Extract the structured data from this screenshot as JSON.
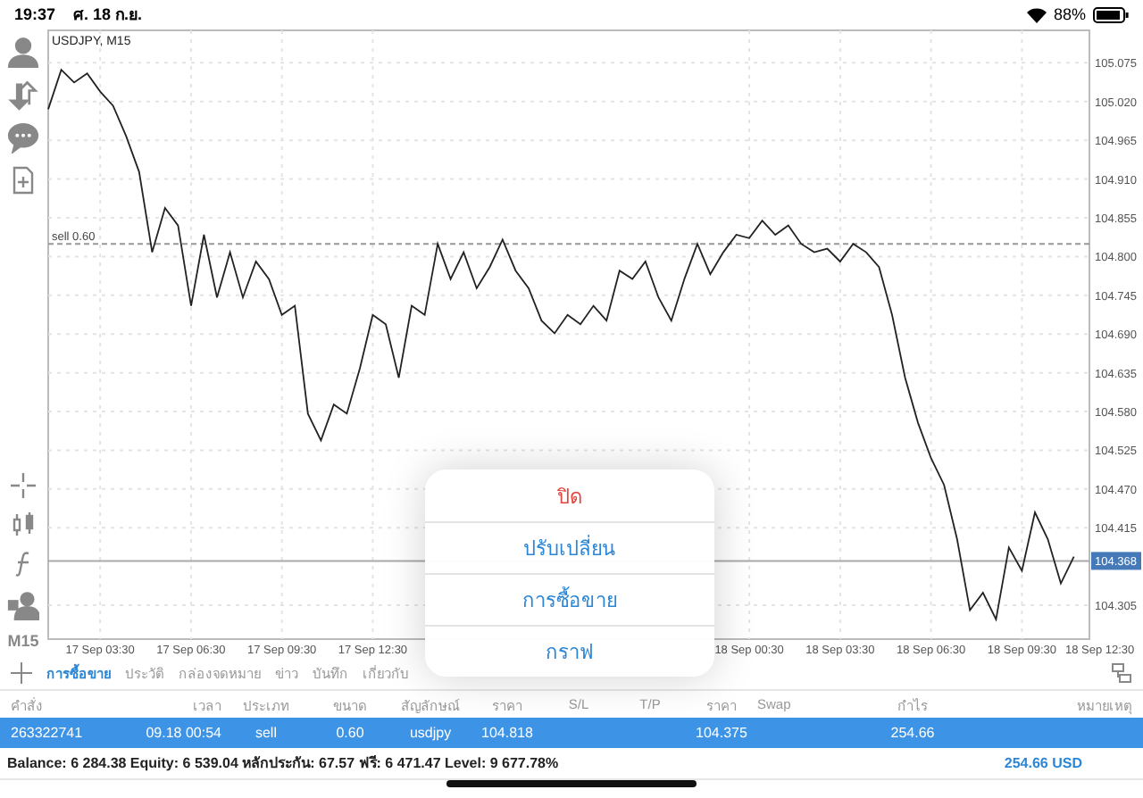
{
  "status_bar": {
    "time": "19:37",
    "date": "ศ. 18 ก.ย.",
    "battery": "88%"
  },
  "toolbar": {
    "timeframe": "M15"
  },
  "chart": {
    "chart_data": {
      "type": "line",
      "title": "USDJPY, M15",
      "grid": true,
      "ylim": [
        104.257,
        105.121
      ],
      "categories": [
        null,
        null,
        null,
        null,
        "17 Sep 03:30",
        null,
        null,
        null,
        null,
        null,
        null,
        "17 Sep 06:30",
        null,
        null,
        null,
        null,
        null,
        null,
        "17 Sep 09:30",
        null,
        null,
        null,
        null,
        null,
        null,
        "17 Sep 12:30",
        null,
        null,
        null,
        null,
        null,
        null,
        null,
        null,
        null,
        null,
        null,
        null,
        null,
        null,
        null,
        null,
        null,
        null,
        null,
        null,
        null,
        null,
        null,
        null,
        null,
        null,
        null,
        null,
        "18 Sep 00:30",
        null,
        null,
        null,
        null,
        null,
        null,
        "18 Sep 03:30",
        null,
        null,
        null,
        null,
        null,
        null,
        "18 Sep 06:30",
        null,
        null,
        null,
        null,
        null,
        null,
        "18 Sep 09:30",
        null,
        null,
        null,
        null,
        null,
        "18 Sep 12:30"
      ],
      "yticks": [
        {
          "value": 105.075,
          "label": "105.075"
        },
        {
          "value": 105.02,
          "label": "105.020"
        },
        {
          "value": 104.965,
          "label": "104.965"
        },
        {
          "value": 104.91,
          "label": "104.910"
        },
        {
          "value": 104.855,
          "label": "104.855"
        },
        {
          "value": 104.8,
          "label": "104.800"
        },
        {
          "value": 104.745,
          "label": "104.745"
        },
        {
          "value": 104.69,
          "label": "104.690"
        },
        {
          "value": 104.635,
          "label": "104.635"
        },
        {
          "value": 104.58,
          "label": "104.580"
        },
        {
          "value": 104.525,
          "label": "104.525"
        },
        {
          "value": 104.47,
          "label": "104.470"
        },
        {
          "value": 104.415,
          "label": "104.415"
        },
        {
          "value": 104.305,
          "label": "104.305"
        }
      ],
      "series": [
        {
          "color": "#222222",
          "values": [
            105.009,
            105.065,
            105.047,
            105.06,
            105.034,
            105.014,
            104.971,
            104.92,
            104.806,
            104.869,
            104.844,
            104.73,
            104.831,
            104.742,
            104.806,
            104.742,
            104.793,
            104.768,
            104.717,
            104.73,
            104.577,
            104.539,
            104.59,
            104.577,
            104.641,
            104.717,
            104.704,
            104.628,
            104.73,
            104.717,
            104.818,
            104.768,
            104.806,
            104.755,
            104.785,
            104.824,
            104.78,
            104.755,
            104.709,
            104.691,
            104.717,
            104.704,
            104.73,
            104.709,
            104.78,
            104.768,
            104.793,
            104.742,
            104.709,
            104.768,
            104.818,
            104.775,
            104.806,
            104.831,
            104.826,
            104.851,
            104.831,
            104.844,
            104.818,
            104.806,
            104.811,
            104.793,
            104.818,
            104.806,
            104.785,
            104.717,
            104.628,
            104.564,
            104.514,
            104.476,
            104.399,
            104.298,
            104.323,
            104.285,
            104.387,
            104.354,
            104.437,
            104.399,
            104.336,
            104.374,
            null,
            null
          ]
        }
      ],
      "ref_lines": [
        {
          "axis": "y",
          "value": 104.818,
          "label": "sell 0.60"
        },
        {
          "axis": "y",
          "value": 104.368,
          "label": "104.368"
        }
      ]
    }
  },
  "tabs": [
    {
      "label": "การซื้อขาย",
      "selected": true
    },
    {
      "label": "ประวัติ",
      "selected": false
    },
    {
      "label": "กล่องจดหมาย",
      "selected": false
    },
    {
      "label": "ข่าว",
      "selected": false
    },
    {
      "label": "บันทึก",
      "selected": false
    },
    {
      "label": "เกี่ยวกับ",
      "selected": false
    }
  ],
  "table": {
    "columns": [
      "คำสั่ง",
      "เวลา",
      "ประเภท",
      "ขนาด",
      "สัญลักษณ์",
      "ราคา",
      "S/L",
      "T/P",
      "ราคา",
      "Swap",
      "กำไร",
      "หมายเหตุ"
    ],
    "rows": [
      {
        "selected": true,
        "cells": [
          "263322741",
          "09.18 00:54",
          "sell",
          "0.60",
          "usdjpy",
          "104.818",
          "",
          "",
          "104.375",
          "",
          "254.66",
          ""
        ]
      }
    ]
  },
  "summary": {
    "text": "Balance: 6 284.38 Equity: 6 539.04 หลักประกัน: 67.57 ฟรี: 6 471.47 Level: 9 677.78%",
    "profit": "254.66  USD"
  },
  "menu": [
    {
      "label": "ปิด",
      "kind": "destructive"
    },
    {
      "label": "ปรับเปลี่ยน",
      "kind": "normal"
    },
    {
      "label": "การซื้อขาย",
      "kind": "normal"
    },
    {
      "label": "กราฟ",
      "kind": "normal"
    }
  ]
}
